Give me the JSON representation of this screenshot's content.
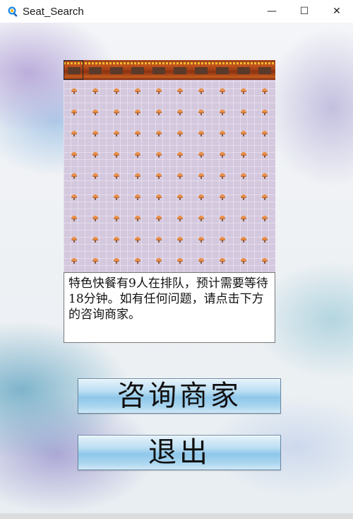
{
  "window": {
    "title": "Seat_Search",
    "icon": "magnifier-app-icon",
    "controls": {
      "minimize": "—",
      "maximize": "☐",
      "close": "✕"
    }
  },
  "seat_map": {
    "rows": 9,
    "cols": 10,
    "counter_segments": 10,
    "colors": {
      "floor": "#d4c8de",
      "seat": "#e9904a",
      "counter": "#9a3d17"
    }
  },
  "info": {
    "text": "特色快餐有9人在排队，预计需要等待18分钟。如有任何问题，请点击下方的咨询商家。"
  },
  "buttons": {
    "consult_label": "咨询商家",
    "exit_label": "退出"
  }
}
